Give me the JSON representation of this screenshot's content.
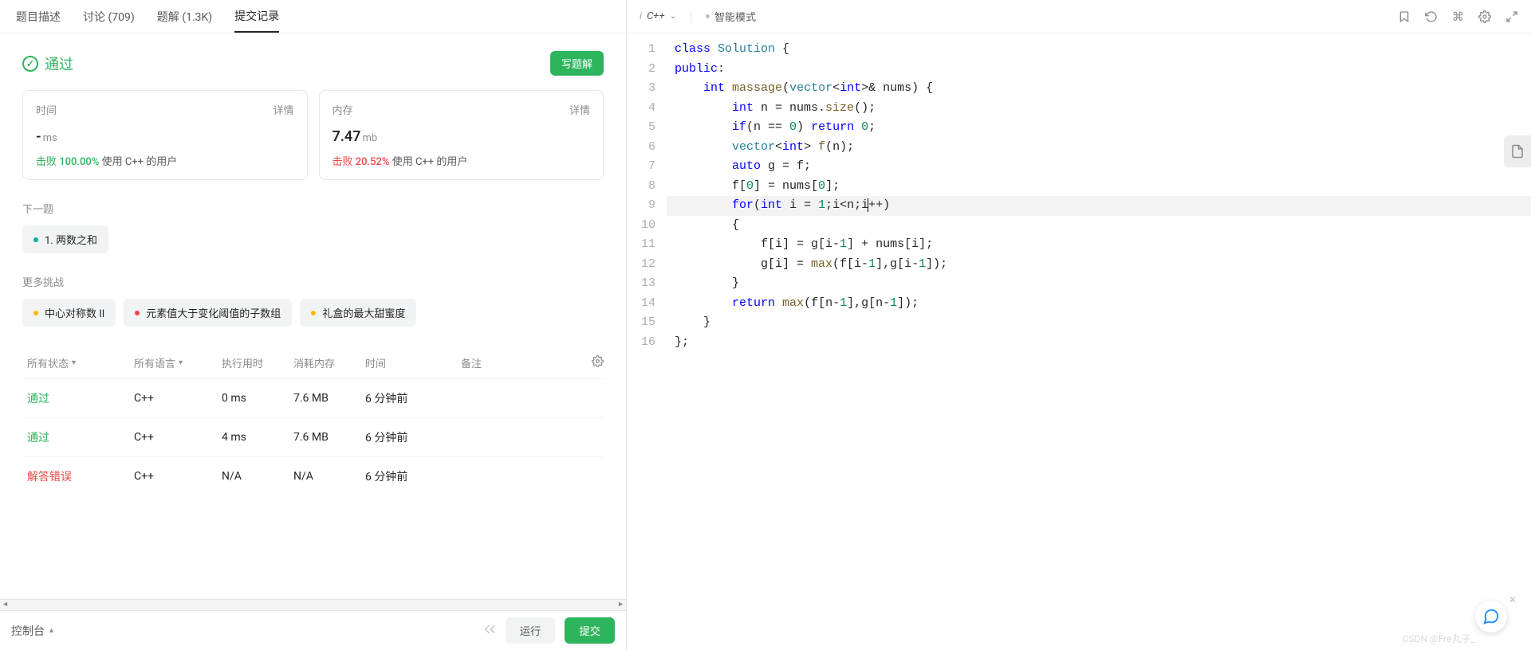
{
  "tabs": {
    "desc": "题目描述",
    "disc": "讨论 (709)",
    "sol": "题解 (1.3K)",
    "sub": "提交记录"
  },
  "result": {
    "status": "通过",
    "write_btn": "写题解"
  },
  "stats": {
    "time": {
      "title": "时间",
      "detail": "详情",
      "value": "-",
      "unit": "ms",
      "beat_label": "击败",
      "beat_pct": "100.00%",
      "users_label": "使用 C++ 的用户"
    },
    "mem": {
      "title": "内存",
      "detail": "详情",
      "value": "7.47",
      "unit": "mb",
      "beat_label": "击败",
      "beat_pct": "20.52%",
      "users_label": "使用 C++ 的用户"
    }
  },
  "next": {
    "label": "下一题",
    "item": "1. 两数之和"
  },
  "more": {
    "label": "更多挑战",
    "items": [
      {
        "dot": "yellow",
        "text": "中心对称数 II"
      },
      {
        "dot": "red",
        "text": "元素值大于变化阈值的子数组"
      },
      {
        "dot": "yellow",
        "text": "礼盒的最大甜蜜度"
      }
    ]
  },
  "table": {
    "hdr": {
      "status": "所有状态",
      "lang": "所有语言",
      "run": "执行用时",
      "mem": "消耗内存",
      "time": "时间",
      "note": "备注"
    },
    "rows": [
      {
        "status": "通过",
        "status_cls": "pass",
        "lang": "C++",
        "run": "0 ms",
        "mem": "7.6 MB",
        "time": "6 分钟前"
      },
      {
        "status": "通过",
        "status_cls": "pass",
        "lang": "C++",
        "run": "4 ms",
        "mem": "7.6 MB",
        "time": "6 分钟前"
      },
      {
        "status": "解答错误",
        "status_cls": "fail",
        "lang": "C++",
        "run": "N/A",
        "mem": "N/A",
        "time": "6 分钟前"
      }
    ]
  },
  "console": {
    "label": "控制台",
    "run": "运行",
    "submit": "提交"
  },
  "editor": {
    "lang": "C++",
    "mode": "智能模式"
  },
  "watermark": "CSDN @Fre丸子_",
  "code_lines": [
    [
      [
        "kw",
        "class"
      ],
      [
        "",
        " "
      ],
      [
        "typ",
        "Solution"
      ],
      [
        "",
        " {"
      ]
    ],
    [
      [
        "kw",
        "public"
      ],
      [
        "",
        ":"
      ]
    ],
    [
      [
        "",
        "    "
      ],
      [
        "kw",
        "int"
      ],
      [
        "",
        " "
      ],
      [
        "fn",
        "massage"
      ],
      [
        "",
        "("
      ],
      [
        "typ",
        "vector"
      ],
      [
        "",
        "<"
      ],
      [
        "kw",
        "int"
      ],
      [
        "",
        ">& nums) {"
      ]
    ],
    [
      [
        "",
        "        "
      ],
      [
        "kw",
        "int"
      ],
      [
        "",
        " n = nums."
      ],
      [
        "fn",
        "size"
      ],
      [
        "",
        "();"
      ]
    ],
    [
      [
        "",
        "        "
      ],
      [
        "kw",
        "if"
      ],
      [
        "",
        "(n == "
      ],
      [
        "num",
        "0"
      ],
      [
        "",
        ") "
      ],
      [
        "kw",
        "return"
      ],
      [
        "",
        " "
      ],
      [
        "num",
        "0"
      ],
      [
        "",
        ";"
      ]
    ],
    [
      [
        "",
        "        "
      ],
      [
        "typ",
        "vector"
      ],
      [
        "",
        "<"
      ],
      [
        "kw",
        "int"
      ],
      [
        "",
        "> "
      ],
      [
        "fn",
        "f"
      ],
      [
        "",
        "(n);"
      ]
    ],
    [
      [
        "",
        "        "
      ],
      [
        "kw",
        "auto"
      ],
      [
        "",
        " g = f;"
      ]
    ],
    [
      [
        "",
        "        f["
      ],
      [
        "num",
        "0"
      ],
      [
        "",
        "] = nums["
      ],
      [
        "num",
        "0"
      ],
      [
        "",
        "];"
      ]
    ],
    [
      [
        "",
        "        "
      ],
      [
        "kw",
        "for"
      ],
      [
        "",
        "("
      ],
      [
        "kw",
        "int"
      ],
      [
        "",
        " i = "
      ],
      [
        "num",
        "1"
      ],
      [
        "",
        ";i<n;i"
      ],
      [
        "cursor",
        ""
      ],
      [
        "",
        "++)"
      ]
    ],
    [
      [
        "",
        "        {"
      ]
    ],
    [
      [
        "",
        "            f[i] = g[i-"
      ],
      [
        "num",
        "1"
      ],
      [
        "",
        "] + nums[i];"
      ]
    ],
    [
      [
        "",
        "            g[i] = "
      ],
      [
        "fn",
        "max"
      ],
      [
        "",
        "(f[i-"
      ],
      [
        "num",
        "1"
      ],
      [
        "",
        "],g[i-"
      ],
      [
        "num",
        "1"
      ],
      [
        "",
        "]);"
      ]
    ],
    [
      [
        "",
        "        }"
      ]
    ],
    [
      [
        "",
        "        "
      ],
      [
        "kw",
        "return"
      ],
      [
        "",
        " "
      ],
      [
        "fn",
        "max"
      ],
      [
        "",
        "(f[n-"
      ],
      [
        "num",
        "1"
      ],
      [
        "",
        "],g[n-"
      ],
      [
        "num",
        "1"
      ],
      [
        "",
        "]);"
      ]
    ],
    [
      [
        "",
        "    }"
      ]
    ],
    [
      [
        "",
        "};"
      ]
    ]
  ]
}
